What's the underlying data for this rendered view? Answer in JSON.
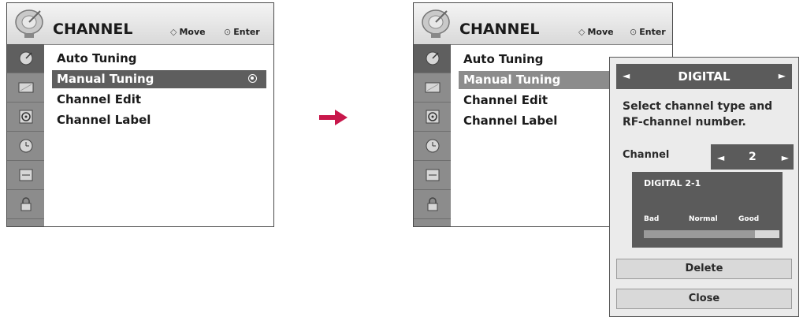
{
  "left_menu": {
    "title": "CHANNEL",
    "hint_move": "Move",
    "hint_enter": "Enter",
    "items": [
      {
        "label": "Auto Tuning",
        "selected": false
      },
      {
        "label": "Manual Tuning",
        "selected": true
      },
      {
        "label": "Channel Edit",
        "selected": false
      },
      {
        "label": "Channel Label",
        "selected": false
      }
    ]
  },
  "right_menu": {
    "title": "CHANNEL",
    "hint_move": "Move",
    "hint_enter": "Enter",
    "items": [
      {
        "label": "Auto Tuning",
        "selected": false
      },
      {
        "label": "Manual Tuning",
        "selected": true
      },
      {
        "label": "Channel Edit",
        "selected": false
      },
      {
        "label": "Channel Label",
        "selected": false
      }
    ]
  },
  "sidebar_icons": [
    "satellite-icon",
    "picture-icon",
    "audio-icon",
    "time-icon",
    "option-icon",
    "lock-icon"
  ],
  "popup": {
    "type_label": "DIGITAL",
    "description": "Select channel type and RF-channel number.",
    "channel_label": "Channel",
    "channel_value": "2",
    "signal_name": "DIGITAL 2-1",
    "signal_levels": [
      "Bad",
      "Normal",
      "Good"
    ],
    "signal_strength": 0.82,
    "delete_label": "Delete",
    "close_label": "Close"
  },
  "colors": {
    "arrow": "#c8174b",
    "highlight": "#5e5e5e",
    "sidebar": "#8c8c8c"
  }
}
